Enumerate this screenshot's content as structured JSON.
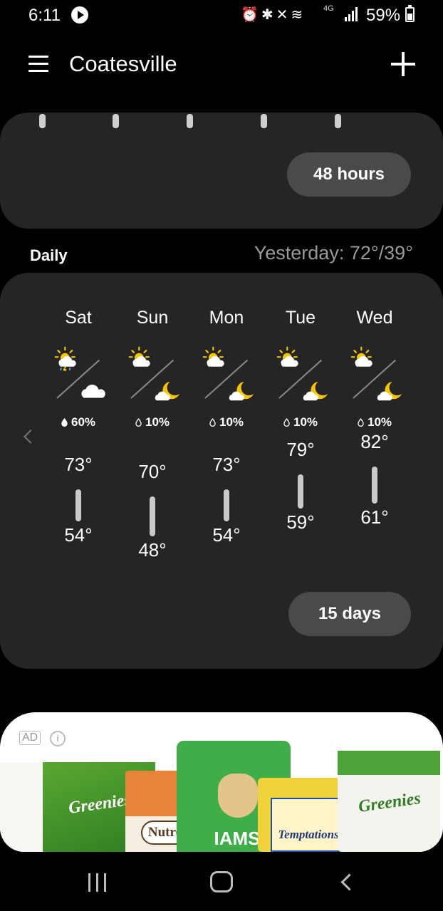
{
  "status_bar": {
    "time": "6:11",
    "network_label": "4G",
    "battery": "59%",
    "battery_level": 0.59
  },
  "app_bar": {
    "location": "Coatesville"
  },
  "hourly": {
    "button_label": "48 hours"
  },
  "daily": {
    "section_label": "Daily",
    "yesterday": "Yesterday: 72°/39°",
    "button_label": "15 days",
    "days": [
      {
        "name": "Sat",
        "day_icon": "partly-sunny-thunderstorm-icon",
        "night_icon": "cloud-icon",
        "precip": "60%",
        "high": "73°",
        "low": "54°"
      },
      {
        "name": "Sun",
        "day_icon": "partly-sunny-icon",
        "night_icon": "moon-cloud-icon",
        "precip": "10%",
        "high": "70°",
        "low": "48°"
      },
      {
        "name": "Mon",
        "day_icon": "partly-sunny-icon",
        "night_icon": "moon-cloud-icon",
        "precip": "10%",
        "high": "73°",
        "low": "54°"
      },
      {
        "name": "Tue",
        "day_icon": "partly-sunny-icon",
        "night_icon": "moon-cloud-icon",
        "precip": "10%",
        "high": "79°",
        "low": "59°"
      },
      {
        "name": "Wed",
        "day_icon": "partly-sunny-icon",
        "night_icon": "moon-cloud-icon",
        "precip": "10%",
        "high": "82°",
        "low": "61°"
      }
    ]
  },
  "ad": {
    "badge": "AD",
    "products": [
      "Greenies",
      "Nutro",
      "IAMS",
      "Temptations",
      "Greenies"
    ]
  },
  "colors": {
    "card_bg": "#252525",
    "button_bg": "#4a4a4a",
    "sun": "#f6c400",
    "secondary_text": "#9a9a9a"
  }
}
